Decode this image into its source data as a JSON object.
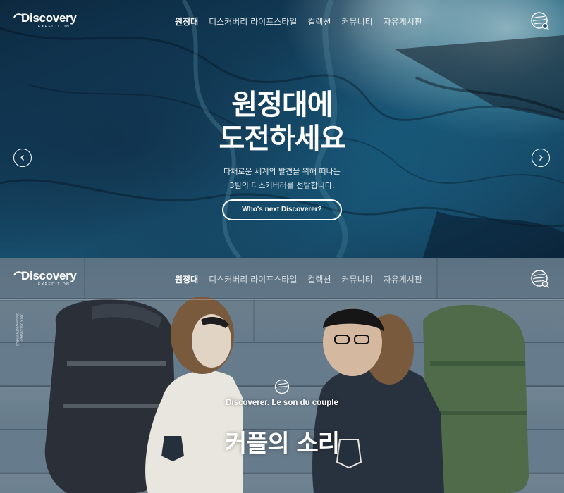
{
  "brand": {
    "logo_text": "Discovery",
    "logo_subtext": "EXPEDITION"
  },
  "nav": {
    "items": [
      {
        "label": "원정대",
        "active": true
      },
      {
        "label": "디스커버리 라이프스타일",
        "active": false
      },
      {
        "label": "컬렉션",
        "active": false
      },
      {
        "label": "커뮤니티",
        "active": false
      },
      {
        "label": "자유게시판",
        "active": false
      }
    ],
    "search_icon": "globe-search-icon"
  },
  "hero": {
    "title_line1": "원정대에",
    "title_line2": "도전하세요",
    "desc_line1": "다채로운 세계의 발견을 위해 떠나는",
    "desc_line2": "3팀의 디스커버러를 선발합니다.",
    "cta_label": "Who's next Discoverer?",
    "prev_icon": "chevron-left-icon",
    "next_icon": "chevron-right-icon"
  },
  "couple": {
    "vertical_caption": "I AM A DISCOVERER  Discovery NEW WORLD",
    "subtitle": "Discoverer. Le son du couple",
    "title": "커플의 소리"
  },
  "colors": {
    "text": "#ffffff",
    "hero_base": "#164c6c",
    "wall": "#6f8594"
  }
}
